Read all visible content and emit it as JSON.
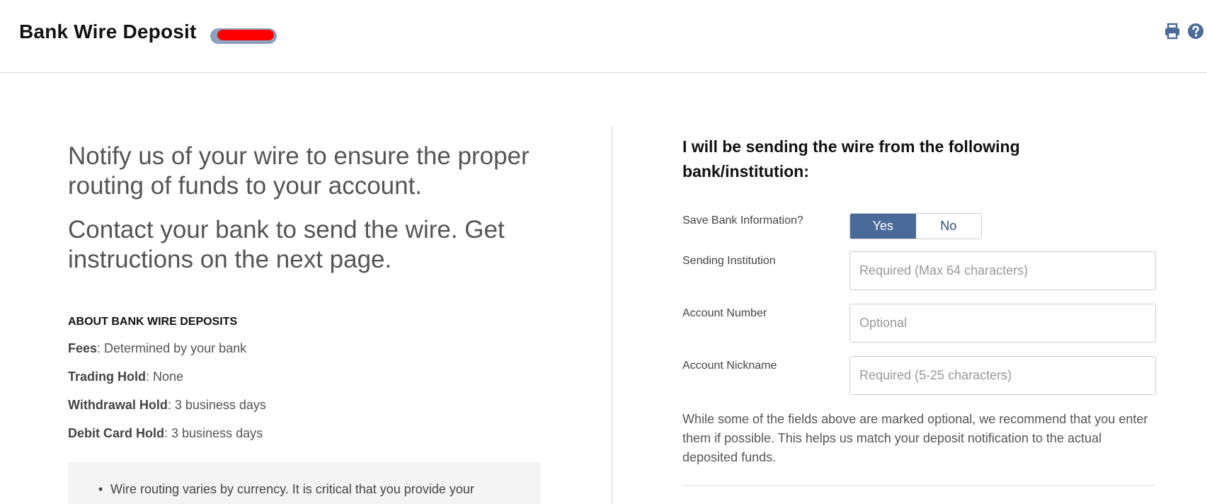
{
  "header": {
    "title": "Bank Wire Deposit",
    "icons": [
      "print-icon",
      "help-icon"
    ]
  },
  "left": {
    "lead1": "Notify us of your wire to ensure the proper routing of funds to your account.",
    "lead2": "Contact your bank to send the wire. Get instructions on the next page.",
    "about_heading": "ABOUT BANK WIRE DEPOSITS",
    "info": [
      {
        "key": "Fees",
        "value": ": Determined by your bank"
      },
      {
        "key": "Trading Hold",
        "value": ": None"
      },
      {
        "key": "Withdrawal Hold",
        "value": ": 3 business days"
      },
      {
        "key": "Debit Card Hold",
        "value": ": 3 business days"
      }
    ],
    "note": "Wire routing varies by currency. It is critical that you provide your"
  },
  "form": {
    "heading": "I will be sending the wire from the following bank/institution:",
    "save_bank_label": "Save Bank Information?",
    "yes_label": "Yes",
    "no_label": "No",
    "selected": "Yes",
    "institution_label": "Sending Institution",
    "institution_placeholder": "Required (Max 64 characters)",
    "account_number_label": "Account Number",
    "account_number_placeholder": "Optional",
    "nickname_label": "Account Nickname",
    "nickname_placeholder": "Required (5-25 characters)",
    "help": "While some of the fields above are marked optional, we recommend that you enter them if possible. This helps us match your deposit notification to the actual deposited funds."
  },
  "colors": {
    "accent": "#4a6a9a",
    "icon": "#4a6a9a",
    "redaction": "#ff0000"
  }
}
